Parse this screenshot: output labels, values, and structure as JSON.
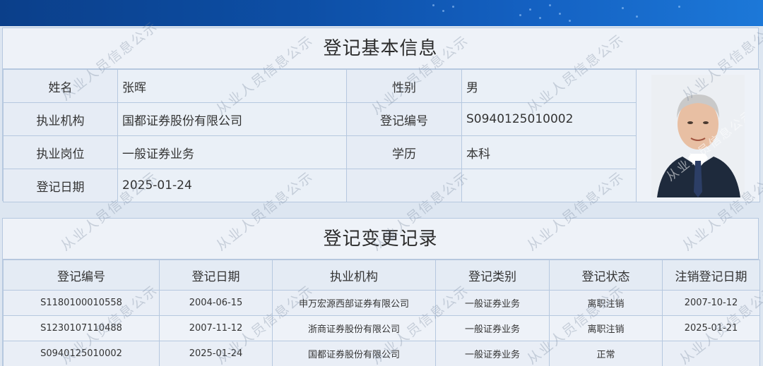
{
  "basic": {
    "title": "登记基本信息",
    "rows": [
      {
        "label1": "姓名",
        "value1": "张晖",
        "label2": "性别",
        "value2": "男"
      },
      {
        "label1": "执业机构",
        "value1": "国都证券股份有限公司",
        "label2": "登记编号",
        "value2": "S0940125010002"
      },
      {
        "label1": "执业岗位",
        "value1": "一般证券业务",
        "label2": "学历",
        "value2": "本科"
      },
      {
        "label1": "登记日期",
        "value1": "2025-01-24",
        "label2": "",
        "value2": ""
      }
    ]
  },
  "records": {
    "title": "登记变更记录",
    "headers": [
      "登记编号",
      "登记日期",
      "执业机构",
      "登记类别",
      "登记状态",
      "注销登记日期"
    ],
    "rows": [
      [
        "S1180100010558",
        "2004-06-15",
        "申万宏源西部证券有限公司",
        "一般证券业务",
        "离职注销",
        "2007-10-12"
      ],
      [
        "S1230107110488",
        "2007-11-12",
        "浙商证券股份有限公司",
        "一般证券业务",
        "离职注销",
        "2025-01-21"
      ],
      [
        "S0940125010002",
        "2025-01-24",
        "国都证券股份有限公司",
        "一般证券业务",
        "正常",
        ""
      ]
    ]
  },
  "watermark": "从业人员信息公示",
  "colors": {
    "banner": "#0d4fa6",
    "panel_bg": "#eef2f8",
    "border": "#b6c8df"
  }
}
